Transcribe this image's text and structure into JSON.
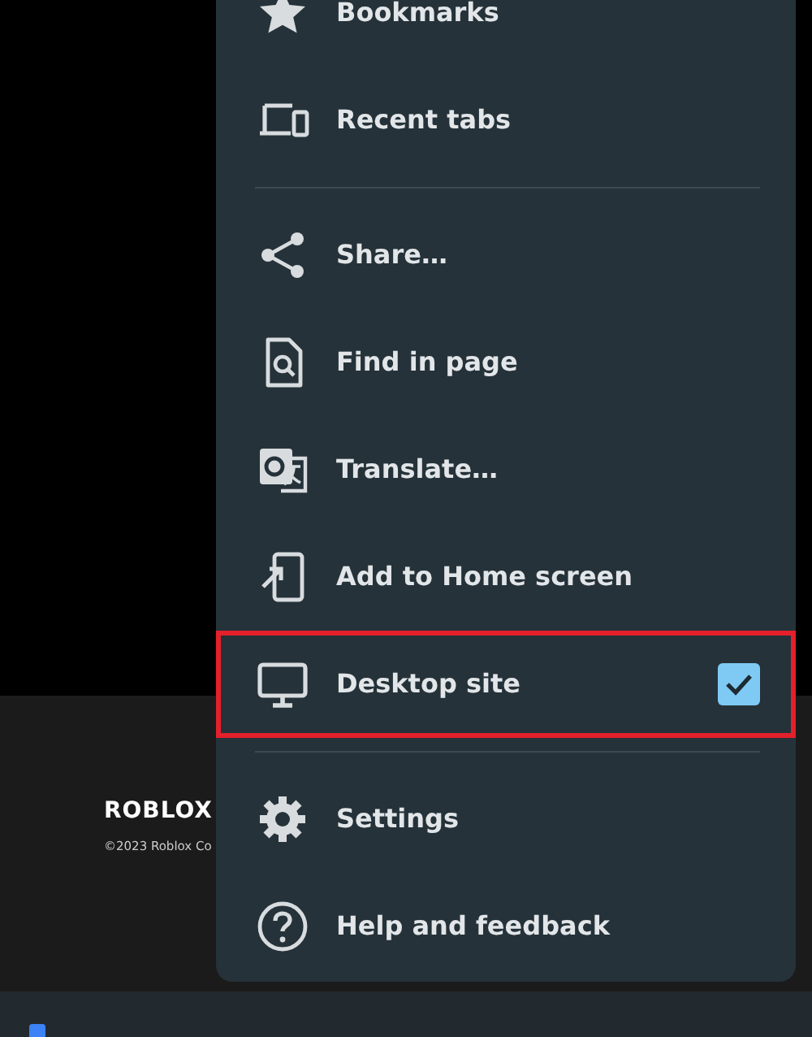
{
  "footer": {
    "brand": "ROBLOX",
    "copyright": "©2023 Roblox Co"
  },
  "menu": {
    "groups": [
      [
        {
          "label": "Bookmarks",
          "highlighted": false
        },
        {
          "label": "Recent tabs",
          "highlighted": false
        }
      ],
      [
        {
          "label": "Share…",
          "highlighted": false
        },
        {
          "label": "Find in page",
          "highlighted": false
        },
        {
          "label": "Translate…",
          "highlighted": false
        },
        {
          "label": "Add to Home screen",
          "highlighted": false
        },
        {
          "label": "Desktop site",
          "highlighted": true,
          "checked": true
        }
      ],
      [
        {
          "label": "Settings",
          "highlighted": false
        },
        {
          "label": "Help and feedback",
          "highlighted": false
        }
      ]
    ]
  }
}
